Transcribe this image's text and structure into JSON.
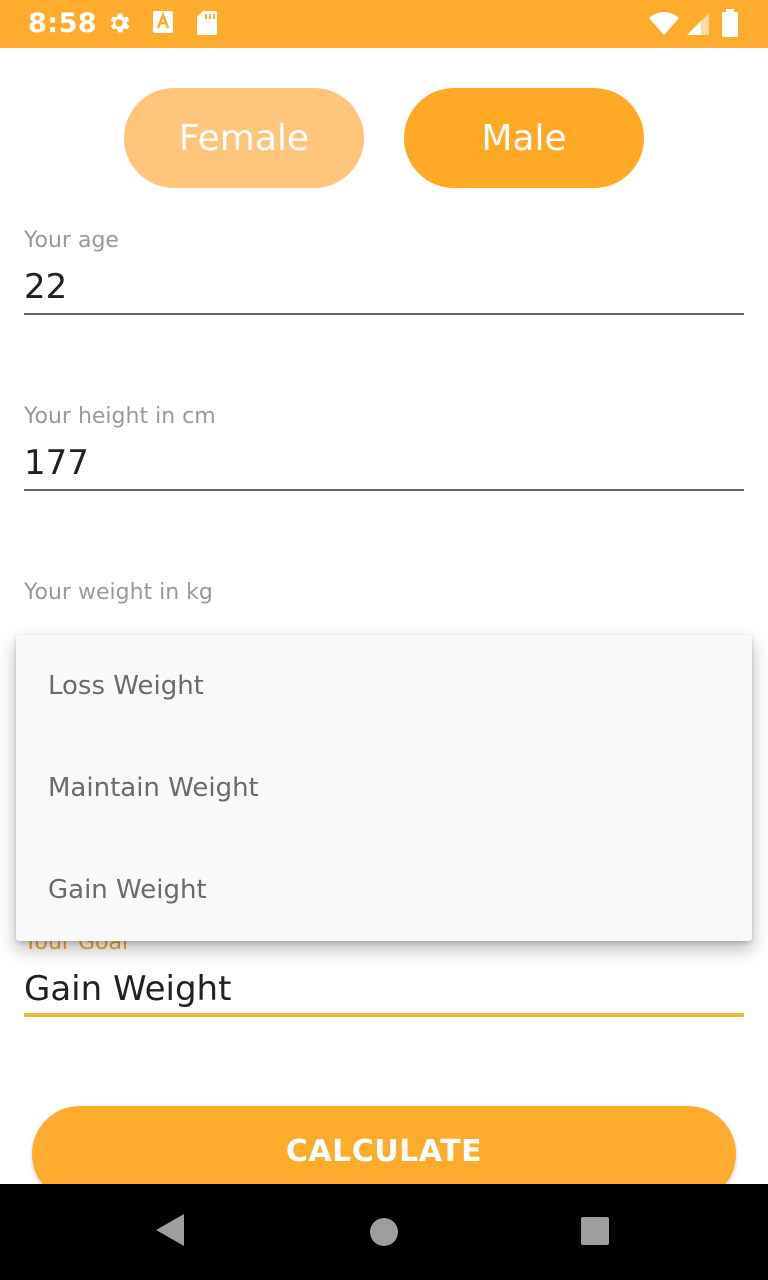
{
  "status_bar": {
    "time": "8:58",
    "icons": [
      "gear-icon",
      "font-a-icon",
      "sd-card-icon",
      "wifi-icon",
      "signal-icon",
      "battery-icon"
    ],
    "color": "#FFAB2E"
  },
  "gender": {
    "female_label": "Female",
    "male_label": "Male",
    "selected": "Male"
  },
  "form": {
    "age": {
      "label": "Your age",
      "value": "22"
    },
    "height": {
      "label": "Your height in cm",
      "value": "177"
    },
    "weight": {
      "label": "Your weight in kg",
      "value": ""
    },
    "goal": {
      "label": "Your Goal",
      "value": "Gain Weight"
    }
  },
  "goal_dropdown": {
    "options": [
      "Loss Weight",
      "Maintain Weight",
      "Gain Weight"
    ]
  },
  "calculate_label": "CALCULATE",
  "nav_bar": {
    "icons": [
      "back-icon",
      "home-icon",
      "recents-icon"
    ]
  },
  "colors": {
    "accent": "#FFAB2E",
    "female_unselected": "#FFC57C"
  }
}
